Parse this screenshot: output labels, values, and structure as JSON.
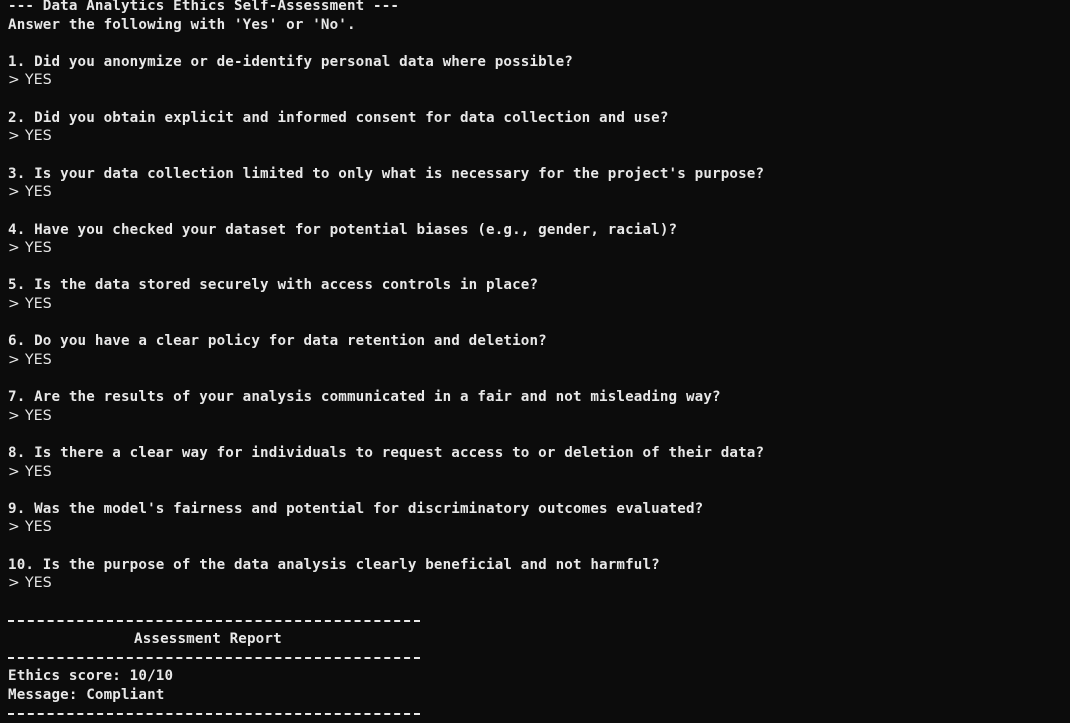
{
  "header": {
    "title": "--- Data Analytics Ethics Self-Assessment ---",
    "instruction": "Answer the following with 'Yes' or 'No'."
  },
  "prompt_symbol": ">",
  "questions": [
    {
      "text": "1. Did you anonymize or de-identify personal data where possible?",
      "answer": "YES"
    },
    {
      "text": "2. Did you obtain explicit and informed consent for data collection and use?",
      "answer": "YES"
    },
    {
      "text": "3. Is your data collection limited to only what is necessary for the project's purpose?",
      "answer": "YES"
    },
    {
      "text": "4. Have you checked your dataset for potential biases (e.g., gender, racial)?",
      "answer": "YES"
    },
    {
      "text": "5. Is the data stored securely with access controls in place?",
      "answer": "YES"
    },
    {
      "text": "6. Do you have a clear policy for data retention and deletion?",
      "answer": "YES"
    },
    {
      "text": "7. Are the results of your analysis communicated in a fair and not misleading way?",
      "answer": "YES"
    },
    {
      "text": "8. Is there a clear way for individuals to request access to or deletion of their data?",
      "answer": "YES"
    },
    {
      "text": "9. Was the model's fairness and potential for discriminatory outcomes evaluated?",
      "answer": "YES"
    },
    {
      "text": "10. Is the purpose of the data analysis clearly beneficial and not harmful?",
      "answer": "YES"
    }
  ],
  "report": {
    "title": "Assessment Report",
    "score_line": "Ethics score: 10/10",
    "message_line": "Message: Compliant"
  },
  "colors": {
    "background": "#0c0c0c",
    "text": "#e8e8e8"
  }
}
